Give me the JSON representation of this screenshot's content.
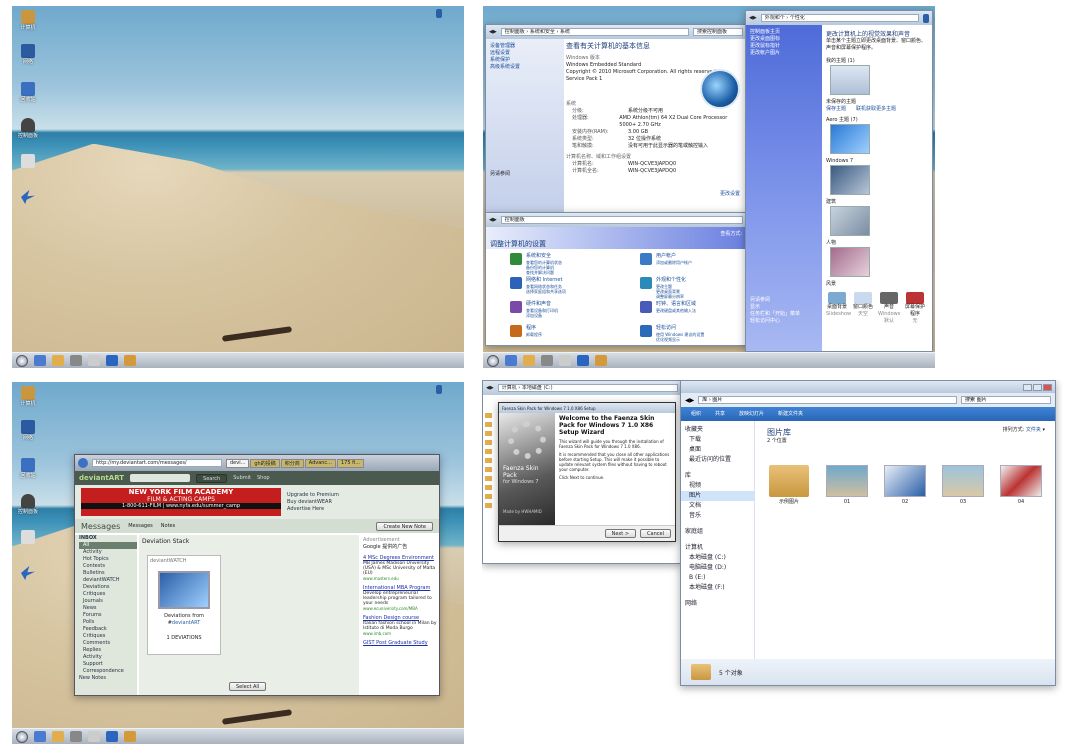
{
  "panels": {
    "top_left": {
      "clock": "",
      "badge": "",
      "icons": [
        {
          "label": "计算机"
        },
        {
          "label": "网络"
        },
        {
          "label": "回收站"
        },
        {
          "label": "控制面板"
        },
        {
          "label": ""
        }
      ]
    },
    "top_right": {
      "system_window": {
        "address": "控制面板 › 系统和安全 › 系统",
        "search": "搜索控制面板",
        "heading": "查看有关计算机的基本信息",
        "edition_label": "Windows 版本",
        "edition": "Windows Embedded Standard",
        "copyright": "Copyright © 2010 Microsoft Corporation. All rights reserved.",
        "service_pack": "Service Pack 1",
        "system_label": "系统",
        "rows": [
          {
            "k": "分级:",
            "v": "系统分级不可用"
          },
          {
            "k": "处理器:",
            "v": "AMD Athlon(tm) 64 X2 Dual Core Processor 5000+ 2.70 GHz"
          },
          {
            "k": "安装内存(RAM):",
            "v": "3.00 GB"
          },
          {
            "k": "系统类型:",
            "v": "32 位操作系统"
          },
          {
            "k": "笔和触摸:",
            "v": "没有可用于此显示器的笔或触控输入"
          }
        ],
        "computer_label": "计算机名称、域和工作组设置",
        "rows2": [
          {
            "k": "计算机名:",
            "v": "WIN-QCVE3JAPDQ0"
          },
          {
            "k": "计算机全名:",
            "v": "WIN-QCVE3JAPDQ0"
          }
        ],
        "change_settings": "更改设置",
        "side_links": [
          "设备管理器",
          "远程设置",
          "系统保护",
          "高级系统设置"
        ],
        "see_also": "另请参阅"
      },
      "control_window": {
        "address": "控制面板",
        "heading": "调整计算机的设置",
        "view_by": "查看方式:",
        "items_left": [
          {
            "title": "系统和安全",
            "sub": "查看您的计算机状态\n备份您的计算机\n查找并解决问题"
          },
          {
            "title": "网络和 Internet",
            "sub": "查看网络状态和任务\n选择家庭组和共享选项"
          },
          {
            "title": "硬件和声音",
            "sub": "查看设备和打印机\n添加设备"
          },
          {
            "title": "程序",
            "sub": "卸载程序"
          }
        ],
        "items_right": [
          {
            "title": "用户帐户",
            "sub": "添加或删除用户帐户"
          },
          {
            "title": "外观和个性化",
            "sub": "更改主题\n更改桌面背景\n调整屏幕分辨率"
          },
          {
            "title": "时钟、语言和区域",
            "sub": "更改键盘或其他输入法"
          },
          {
            "title": "轻松访问",
            "sub": "使用 Windows 建议的设置\n优化视频显示"
          }
        ]
      },
      "personalize_window": {
        "address": "外观和个 › 个性化",
        "heading": "更改计算机上的视觉效果和声音",
        "sub": "单击某个主题立即更改桌面背景、窗口颜色、声音和屏幕保护程序。",
        "side_links": [
          "控制面板主页",
          "更改桌面图标",
          "更改鼠标指针",
          "更改帐户图片"
        ],
        "my_themes": "我的主题 (1)",
        "unsaved": "未保存的主题",
        "save_theme": "保存主题",
        "online": "联机获取更多主题",
        "aero": "Aero 主题 (7)",
        "themes": [
          "Windows 7",
          "建筑",
          "人物",
          "风景"
        ],
        "see_also": "另请参阅",
        "see_links": [
          "显示",
          "任务栏和「开始」菜单",
          "轻松访问中心"
        ],
        "bottom": [
          "桌面背景",
          "窗口颜色",
          "声音",
          "屏幕保护程序"
        ],
        "bottom_sub": [
          "Slideshow",
          "天空",
          "Windows 默认",
          "无"
        ],
        "badge": ""
      },
      "clock": ""
    },
    "bottom_left": {
      "badge": "",
      "browser": {
        "url": "http://my.deviantart.com/messages/",
        "tabs": [
          "devi...",
          "gh的投稿",
          "积分商",
          "Advanc...",
          "175 fi..."
        ],
        "logo": "deviantART",
        "search_btn": "Search",
        "nav": [
          "Submit",
          "Shop"
        ],
        "ad_line1": "NEW YORK FILM ACADEMY",
        "ad_line2": "FILM & ACTING CAMPS",
        "ad_line3": "1-800-611-FILM | www.nyfa.edu/summer_camp",
        "premium": "Upgrade to Premium\nBuy deviantWEAR\nAdvertise Here",
        "messages_title": "Messages",
        "tab_messages": "Messages",
        "tab_notes": "Notes",
        "create_note": "Create New Note",
        "inbox": "INBOX",
        "folders": [
          "All",
          "Activity",
          "Hot Topics",
          "Contests",
          "Bulletins",
          "deviantWATCH",
          "Deviations",
          "Critiques",
          "Journals",
          "News",
          "Forums",
          "Polls",
          "Feedback",
          "Critiques",
          "Comments",
          "Replies",
          "Activity",
          "Support",
          "Correspondence"
        ],
        "new_notes": "New Notes",
        "stack_title": "Deviation Stack",
        "stack_box": "deviantWATCH",
        "stack_from": "Deviations from #",
        "stack_link": "deviantART",
        "stack_count": "1 DEVIATIONS",
        "select_all": "Select All",
        "advertisement": "Advertisement",
        "google": "Google 提供的广告",
        "ads": [
          {
            "title": "4 MSc Degrees Environment",
            "body": "MB James Madison University (USA) & MSc University of Malta (EU)",
            "url": "www.masters.edu"
          },
          {
            "title": "International MBA Program",
            "body": "Develop entrepreneurial leadership program tailored to your needs",
            "url": "www.ecuniversity.com/MBA"
          },
          {
            "title": "Fashion Design course",
            "body": "Italian fashion school in Milan by Istituto di Moda Burgo",
            "url": "www.imb.com"
          },
          {
            "title": "GIST Post Graduate Study",
            "body": "",
            "url": ""
          }
        ]
      },
      "icons": [
        {
          "label": "计算机"
        },
        {
          "label": "网络"
        },
        {
          "label": "回收站"
        },
        {
          "label": "控制面板"
        },
        {
          "label": ""
        }
      ],
      "clock": ""
    },
    "bottom_right": {
      "behind_window": {
        "address": "计算机 › 本地磁盘 (C:)",
        "items": [
          "",
          "",
          "",
          "",
          "",
          "",
          "",
          "",
          "",
          "",
          ""
        ]
      },
      "setup": {
        "title": "Faenza Skin Pack for Windows 7 1.0 X86 Setup",
        "side_title": "Faenza Skin Pack",
        "side_sub": "for Windows 7",
        "made_by": "Made by HWHAMID",
        "heading": "Welcome to the Faenza Skin Pack for Windows 7 1.0 X86 Setup Wizard",
        "p1": "This wizard will guide you through the installation of Faenza Skin Pack for Windows 7 1.0 X86.",
        "p2": "It is recommended that you close all other applications before starting Setup. This will make it possible to update relevant system files without having to reboot your computer.",
        "p3": "Click Next to continue.",
        "next": "Next >",
        "cancel": "Cancel"
      },
      "explorer": {
        "address": "库 › 图片",
        "search": "搜索 图片",
        "toolbar": [
          "组织",
          "共享",
          "放映幻灯片",
          "新建文件夹"
        ],
        "nav": {
          "favorites": "收藏夹",
          "fav_items": [
            "下载",
            "桌面",
            "最近访问的位置"
          ],
          "libraries": "库",
          "lib_items": [
            "视频",
            "图片",
            "文档",
            "音乐"
          ],
          "homegroup": "家庭组",
          "computer": "计算机",
          "comp_items": [
            "本地磁盘 (C:)",
            "电脑磁盘 (D:)",
            "B (E:)",
            "本地磁盘 (F:)"
          ],
          "network": "网络"
        },
        "lib_title": "图片库",
        "lib_sub": "2 个位置",
        "arrange": "排列方式:",
        "arrange_val": "文件夹",
        "files": [
          "示例图片",
          "01",
          "02",
          "03",
          "04"
        ],
        "status": "5 个对象"
      }
    }
  }
}
